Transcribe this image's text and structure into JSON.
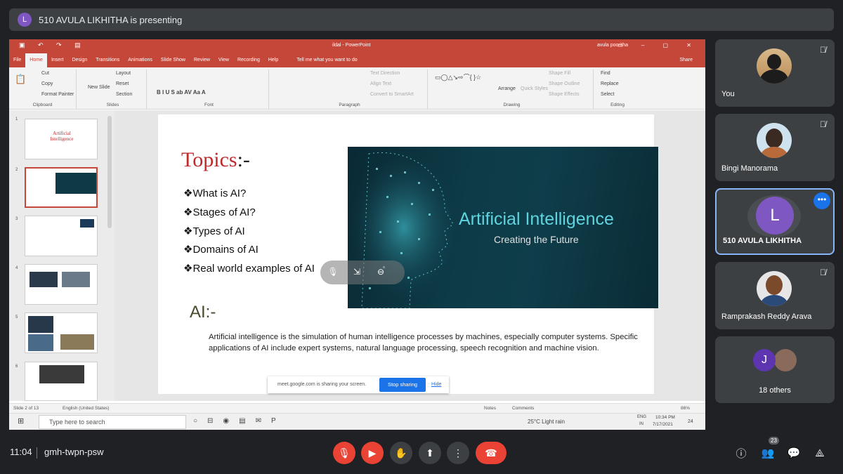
{
  "presenting_banner": {
    "initial": "L",
    "text": "510 AVULA LIKHITHA is presenting"
  },
  "ppt": {
    "window_title": "ildal - PowerPoint",
    "user": "avula pooritha",
    "tabs": [
      "File",
      "Home",
      "Insert",
      "Design",
      "Transitions",
      "Animations",
      "Slide Show",
      "Review",
      "View",
      "Recording",
      "Help"
    ],
    "tell_me": "Tell me what you want to do",
    "share": "Share",
    "ribbon": {
      "clipboard": {
        "label": "Clipboard",
        "paste": "Paste",
        "cut": "Cut",
        "copy": "Copy",
        "format_painter": "Format Painter"
      },
      "slides": {
        "label": "Slides",
        "new_slide": "New Slide",
        "layout": "Layout",
        "reset": "Reset",
        "section": "Section"
      },
      "font": {
        "label": "Font"
      },
      "paragraph": {
        "label": "Paragraph",
        "text_direction": "Text Direction",
        "align_text": "Align Text",
        "smartart": "Convert to SmartArt"
      },
      "drawing": {
        "label": "Drawing",
        "arrange": "Arrange",
        "quick_styles": "Quick Styles",
        "shape_fill": "Shape Fill",
        "shape_outline": "Shape Outline",
        "shape_effects": "Shape Effects"
      },
      "editing": {
        "label": "Editing",
        "find": "Find",
        "replace": "Replace",
        "select": "Select"
      }
    },
    "thumb_numbers": [
      "1",
      "2",
      "3",
      "4",
      "5",
      "6"
    ],
    "thumb1_text": "Artificial Intelligence",
    "slide": {
      "topics_title": "Topics",
      "topics_suffix": ":-",
      "bullets": [
        "❖What is AI?",
        "❖Stages of AI?",
        "❖Types of AI",
        "❖Domains of AI",
        "❖Real world examples of AI"
      ],
      "ai_title": "AI:-",
      "ai_desc": "Artificial intelligence is the simulation of human intelligence processes by machines, especially computer systems. Specific applications of AI include expert systems, natural language processing, speech recognition and machine vision.",
      "image_title": "Artificial Intelligence",
      "image_subtitle": "Creating the Future"
    },
    "meet_bar": {
      "message": "meet.google.com is sharing your screen.",
      "stop": "Stop sharing",
      "hide": "Hide"
    },
    "status": {
      "slide": "Slide 2 of 13",
      "lang": "English (United States)",
      "notes": "Notes",
      "comments": "Comments",
      "zoom": "86%"
    },
    "taskbar": {
      "search": "Type here to search",
      "weather": "25°C  Light rain",
      "lang1": "ENG",
      "lang2": "IN",
      "time": "10:34 PM",
      "date": "7/17/2021",
      "notif": "24"
    }
  },
  "participants": [
    {
      "name": "You"
    },
    {
      "name": "Bingi Manorama"
    },
    {
      "name": "510 AVULA LIKHITHA",
      "initial": "L"
    },
    {
      "name": "Ramprakash Reddy Arava"
    },
    {
      "name": "18 others",
      "initial": "J"
    }
  ],
  "bottom": {
    "time": "11:04",
    "code": "gmh-twpn-psw",
    "people_count": "23"
  },
  "colors": {
    "ppt_accent": "#c5473a",
    "meet_bg": "#202124",
    "tile_bg": "#3c4043",
    "end_call": "#ea4335",
    "stop_sharing": "#1a73e8",
    "active_tile_border": "#8ab4f8"
  }
}
